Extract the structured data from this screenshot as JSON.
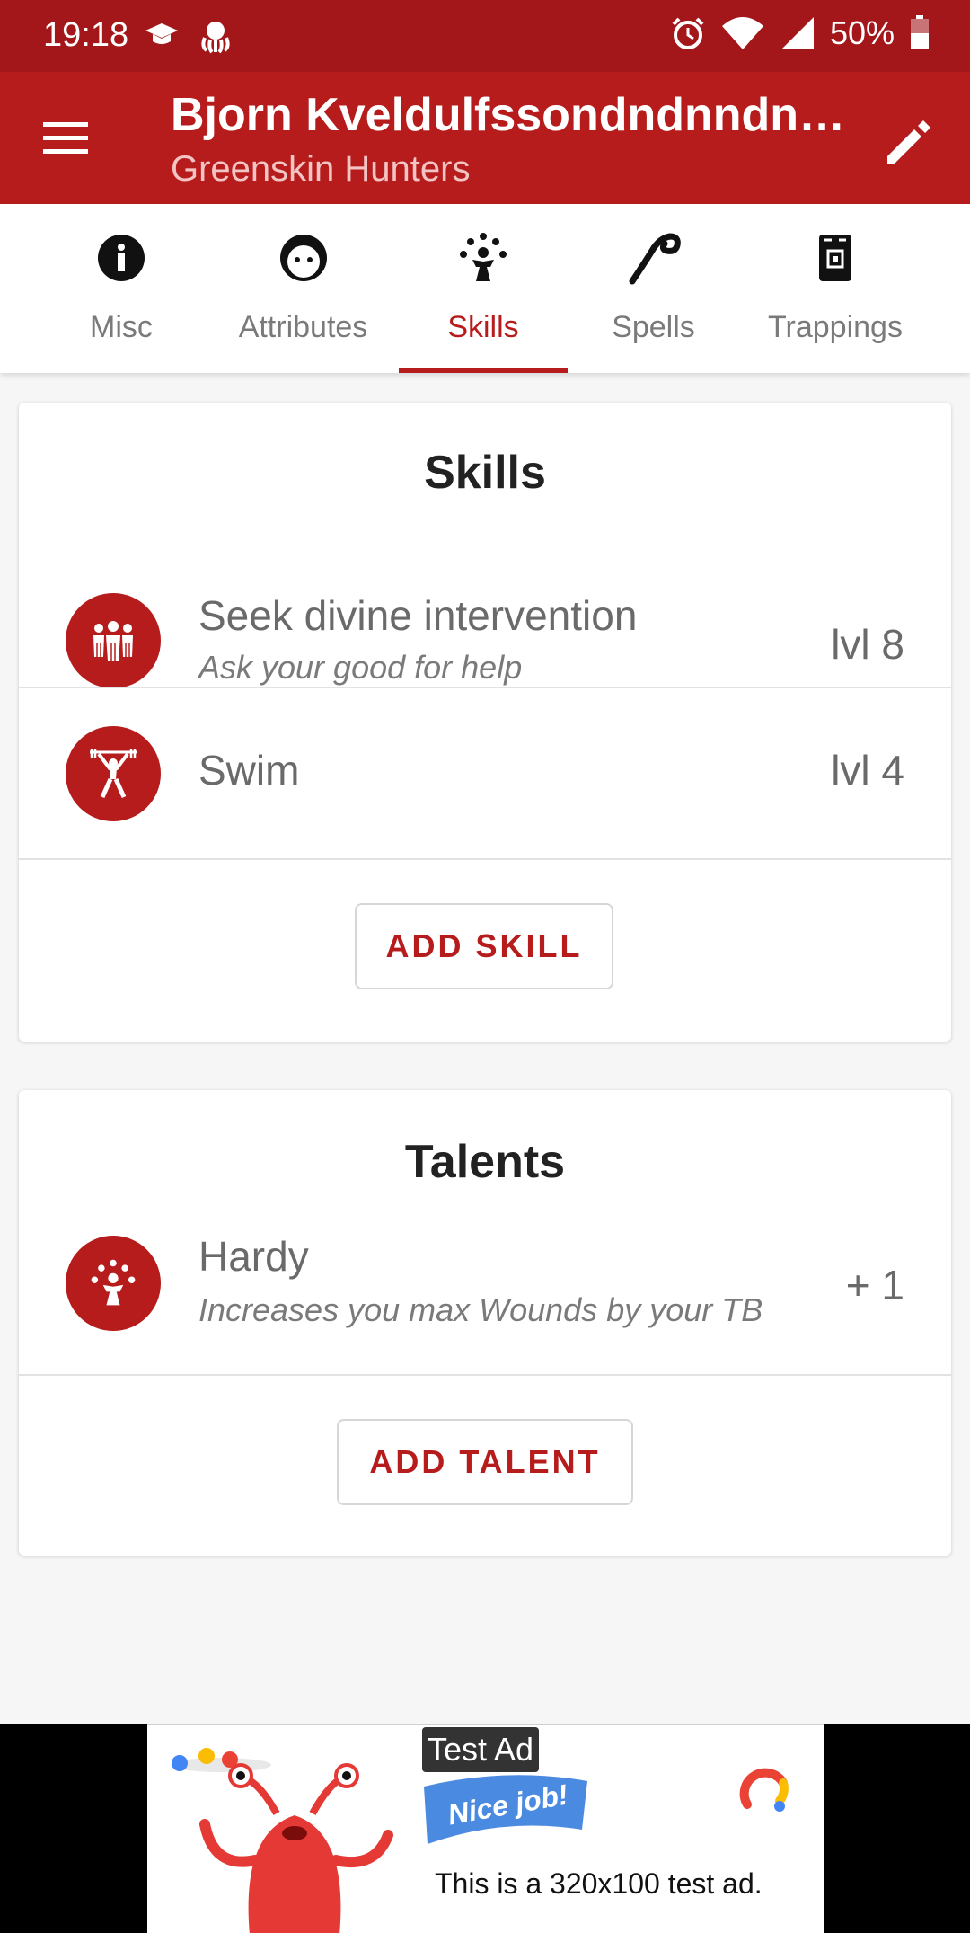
{
  "status_bar": {
    "time": "19:18",
    "battery": "50%"
  },
  "app_bar": {
    "title": "Bjorn Kveldulfssondndnndns…",
    "subtitle": "Greenskin Hunters"
  },
  "tabs": [
    {
      "label": "Misc",
      "icon": "info-icon"
    },
    {
      "label": "Attributes",
      "icon": "face-icon"
    },
    {
      "label": "Skills",
      "icon": "juggler-icon",
      "active": true
    },
    {
      "label": "Spells",
      "icon": "magic-swirl-icon"
    },
    {
      "label": "Trappings",
      "icon": "backpack-icon"
    }
  ],
  "skills_card": {
    "title": "Skills",
    "items": [
      {
        "name": "Seek divine intervention",
        "description": "Ask your good for help",
        "level": "lvl 8",
        "icon": "group-icon"
      },
      {
        "name": "Swim",
        "description": "",
        "level": "lvl 4",
        "icon": "weightlifter-icon"
      }
    ],
    "add_button": "ADD SKILL"
  },
  "talents_card": {
    "title": "Talents",
    "items": [
      {
        "name": "Hardy",
        "description": "Increases you max Wounds by your TB",
        "value": "+ 1",
        "icon": "juggler-icon"
      }
    ],
    "add_button": "ADD TALENT"
  },
  "ad": {
    "label": "Test Ad",
    "flag_text": "Nice job!",
    "text": "This is a 320x100 test ad."
  },
  "colors": {
    "primary": "#b71c1c",
    "status_bar": "#a3171b",
    "background": "#f7f6f7"
  }
}
